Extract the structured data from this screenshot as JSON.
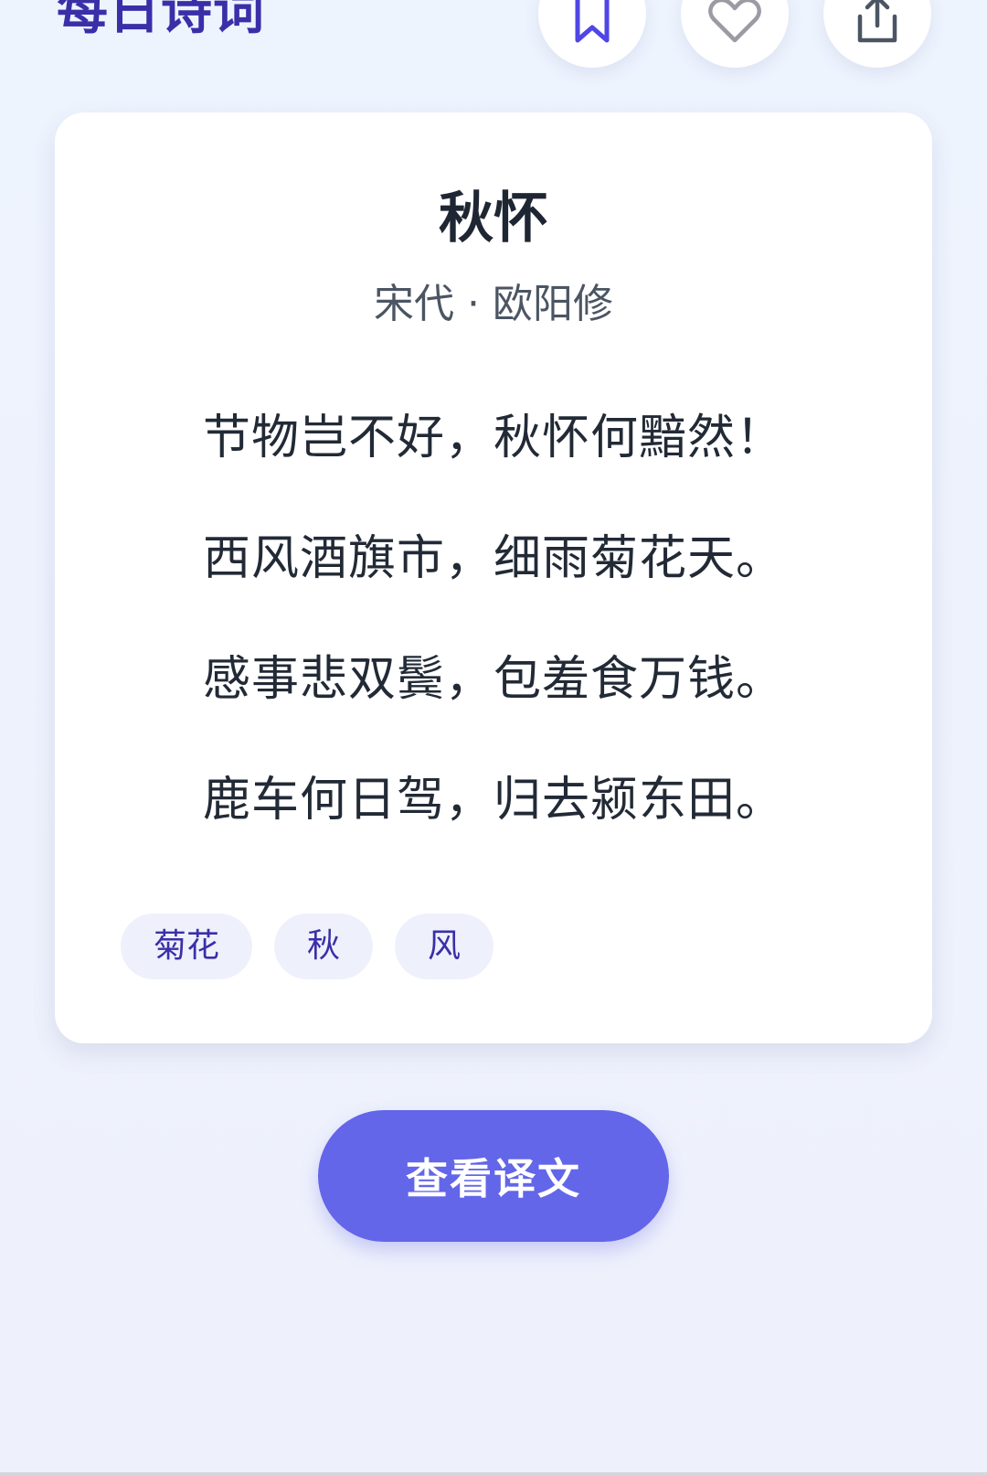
{
  "header": {
    "app_title": "每日诗词"
  },
  "actions": {
    "bookmark_icon": "bookmark-icon",
    "like_icon": "heart-icon",
    "share_icon": "share-icon"
  },
  "poem": {
    "title": "秋怀",
    "meta": "宋代 · 欧阳修",
    "lines": [
      "节物岂不好，秋怀何黯然！",
      "西风酒旗市，细雨菊花天。",
      "感事悲双鬓，包羞食万钱。",
      "鹿车何日驾，归去颍东田。"
    ],
    "tags": [
      "菊花",
      "秋",
      "风"
    ]
  },
  "translate_button": {
    "label": "查看译文"
  },
  "colors": {
    "accent": "#3b2fa8",
    "button": "#6366e8",
    "background": "#eef2fd",
    "tag_background": "#eef1fb"
  }
}
